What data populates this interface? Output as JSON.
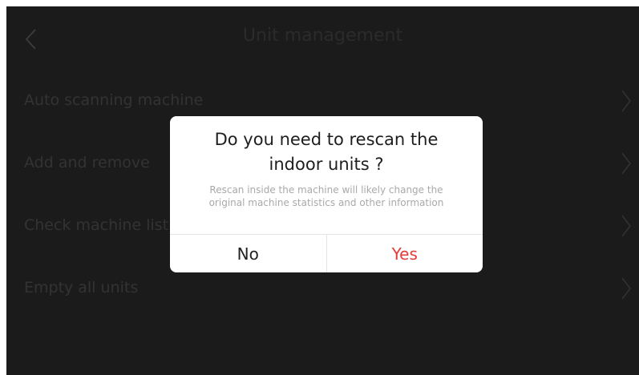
{
  "header": {
    "title": "Unit management",
    "back_icon": "chevron-left-icon"
  },
  "menu": {
    "items": [
      {
        "label": "Auto scanning machine",
        "icon": "chevron-right-icon"
      },
      {
        "label": "Add and remove",
        "icon": "chevron-right-icon"
      },
      {
        "label": "Check machine list",
        "icon": "chevron-right-icon"
      },
      {
        "label": "Empty all units",
        "icon": "chevron-right-icon"
      }
    ]
  },
  "dialog": {
    "title": "Do you need to rescan the indoor units ?",
    "message": "Rescan inside the machine will likely change the original machine statistics and other information",
    "no_label": "No",
    "yes_label": "Yes"
  },
  "colors": {
    "background": "#1b1b1b",
    "dialog_bg": "#ffffff",
    "accent": "#e23b3b",
    "muted_text": "#a9a9a9"
  }
}
